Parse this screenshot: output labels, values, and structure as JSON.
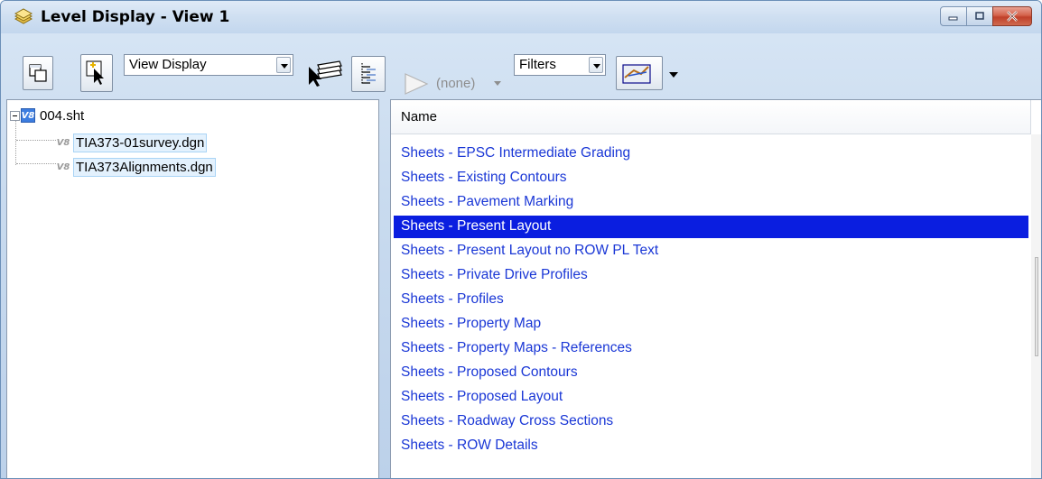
{
  "window": {
    "title": "Level Display - View 1",
    "controls": [
      "minimize",
      "maximize",
      "close"
    ]
  },
  "toolbar": {
    "display_select": "View Display",
    "symbology_selector": "(none)",
    "filters_select": "Filters",
    "icons": [
      "fit-views-icon",
      "select-element-icon",
      "level-manager-icon",
      "tree-view-icon",
      "symbology-icon",
      "highlight-icon"
    ]
  },
  "tree": {
    "root": "004.sht",
    "children": [
      "TIA373-01survey.dgn",
      "TIA373Alignments.dgn"
    ]
  },
  "list": {
    "column_header": "Name",
    "items": [
      "Sheets - EPSC Intermediate Grading",
      "Sheets - Existing Contours",
      "Sheets - Pavement Marking",
      "Sheets - Present Layout",
      "Sheets - Present Layout no ROW PL Text",
      "Sheets - Private Drive Profiles",
      "Sheets - Profiles",
      "Sheets - Property Map",
      "Sheets - Property Maps - References",
      "Sheets - Proposed Contours",
      "Sheets - Proposed Layout",
      "Sheets - Roadway Cross Sections",
      "Sheets - ROW Details"
    ],
    "selected_index": 3
  },
  "colors": {
    "selection": "#0a1ee0",
    "list_text": "#1a37d6",
    "close_button": "#c8452e"
  }
}
